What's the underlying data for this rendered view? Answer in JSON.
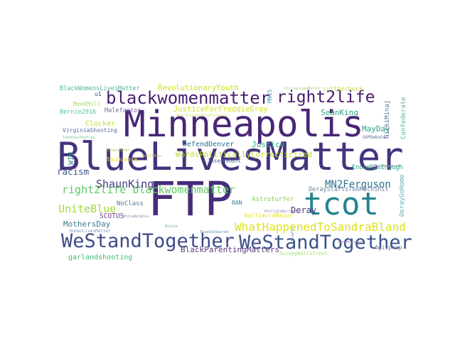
{
  "words": [
    {
      "text": "BlueLivesMatter",
      "color": "#46337e"
    },
    {
      "text": "FTP",
      "color": "#472c7a"
    },
    {
      "text": "Minneapolis",
      "color": "#482677"
    },
    {
      "text": "tcot",
      "color": "#25838e"
    },
    {
      "text": "WeStandTogether",
      "color": "#3e4a89"
    },
    {
      "text": "WeStandTogether",
      "color": "#3b528b"
    },
    {
      "text": "blackwomenmatter",
      "color": "#481f70"
    },
    {
      "text": "right2life",
      "color": "#481a6c"
    },
    {
      "text": "right2life blackwomenmatter",
      "color": "#5ec962"
    },
    {
      "text": "WhatHappenedToSandraBland",
      "color": "#dde318"
    },
    {
      "text": "BlackParentingMatters",
      "color": "#5c3c7e"
    },
    {
      "text": "ShaunKing",
      "color": "#433e85"
    },
    {
      "text": "MN2Ferguson",
      "color": "#2c718e"
    },
    {
      "text": "UniteBlue",
      "color": "#a0da39"
    },
    {
      "text": "racism",
      "color": "#39568c"
    },
    {
      "text": "Deray",
      "color": "#453781"
    },
    {
      "text": "MothersDay",
      "color": "#3e7a8e"
    },
    {
      "text": "Clocker",
      "color": "#b5de2b"
    },
    {
      "text": "RevolutionaryYouth",
      "color": "#d0e11c"
    },
    {
      "text": "JusticeForFreddieGray",
      "color": "#d8e219"
    },
    {
      "text": "SeanKing",
      "color": "#31a08a"
    },
    {
      "text": "MayDay",
      "color": "#2a9d8f"
    },
    {
      "text": "Justice",
      "color": "#29af7f"
    },
    {
      "text": "DefendDenver",
      "color": "#2d708e"
    },
    {
      "text": "WordsPoliticallyCorrecticized",
      "color": "#b8de29"
    },
    {
      "text": "EnoughIsEnough",
      "color": "#21a685"
    },
    {
      "text": "NoClass",
      "color": "#5b7a9e"
    },
    {
      "text": "SCOTUS",
      "color": "#6a3e8a"
    },
    {
      "text": "Astroturfer",
      "color": "#7ad151"
    },
    {
      "text": "BaltimoreMayor",
      "color": "#e5e419"
    },
    {
      "text": "DerayStartsTooMuchShit",
      "color": "#6a82a0"
    },
    {
      "text": "garlandshooting",
      "color": "#3fbc73"
    },
    {
      "text": "Agitprop",
      "color": "#6a6a8e"
    },
    {
      "text": "VirginiaShooting",
      "color": "#5a6a9e"
    },
    {
      "text": "Bernie2016",
      "color": "#52c3a0"
    },
    {
      "text": "BlackWomensLivesMatter",
      "color": "#4fb59a"
    },
    {
      "text": "Malefactor",
      "color": "#7a6a9e"
    },
    {
      "text": "MeekMill",
      "color": "#a8d860"
    },
    {
      "text": "JosephKent",
      "color": "#4a6aa0"
    },
    {
      "text": "SanDubose",
      "color": "#f0e040"
    },
    {
      "text": "cutthecheck",
      "color": "#c8e040"
    },
    {
      "text": "GOPDebate",
      "color": "#5a6a9e"
    },
    {
      "text": "BAN",
      "color": "#3a8a9e"
    },
    {
      "text": "u1",
      "color": "#3a4a8e"
    },
    {
      "text": "HumanLivesMatter",
      "color": "#7a9aba"
    },
    {
      "text": "OccupyWallStreet",
      "color": "#a0e070"
    },
    {
      "text": "WIN",
      "color": "#2a8a8e"
    },
    {
      "text": "MN15",
      "color": "#4aa0b0"
    },
    {
      "text": "NickiMinaj",
      "color": "#5a7aa0"
    },
    {
      "text": "Confederate",
      "color": "#5ab0a0"
    },
    {
      "text": "DerayGoHome",
      "color": "#5ab0b0"
    },
    {
      "text": "PoliceLivesMatter",
      "color": "#a0d070"
    },
    {
      "text": "WhatILearnedFromFerguson",
      "color": "#d0e070"
    },
    {
      "text": "TakeDownTheFlag",
      "color": "#80c0a0"
    },
    {
      "text": "JosephPonder",
      "color": "#b0d060"
    },
    {
      "text": "ShutItDown",
      "color": "#c0d060"
    },
    {
      "text": "PhillyIsBaltimore",
      "color": "#9a7aaa"
    },
    {
      "text": "Philadelphia",
      "color": "#8a8aaa"
    },
    {
      "text": "Police",
      "color": "#6a9aaa"
    },
    {
      "text": "BlackIsSacred",
      "color": "#4a8aaa"
    },
    {
      "text": "TonyRobinson",
      "color": "#9a7aaa"
    },
    {
      "text": "JustineDamond",
      "color": "#9a8aaa"
    },
    {
      "text": "BlueFlu",
      "color": "#5a8aaa"
    }
  ]
}
